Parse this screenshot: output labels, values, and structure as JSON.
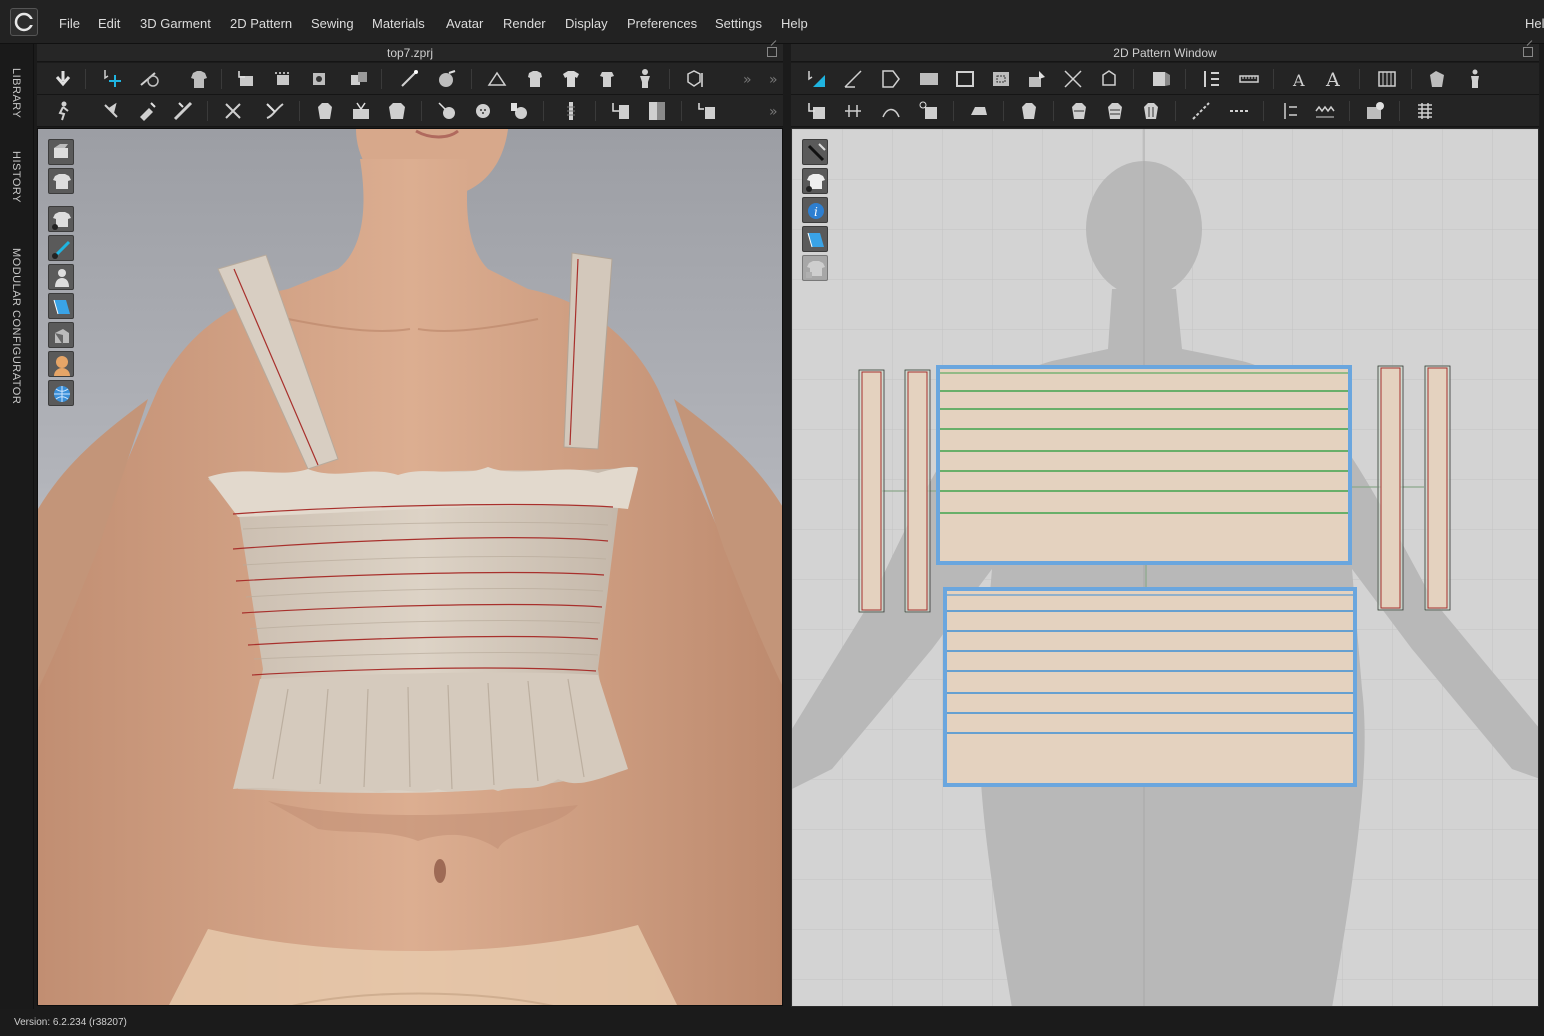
{
  "app": {
    "help_cut": "Hel",
    "menu": [
      "File",
      "Edit",
      "3D Garment",
      "2D Pattern",
      "Sewing",
      "Materials",
      "Avatar",
      "Render",
      "Display",
      "Preferences",
      "Settings",
      "Help"
    ]
  },
  "sidebar": {
    "tabs": [
      "LIBRARY",
      "HISTORY",
      "MODULAR CONFIGURATOR"
    ]
  },
  "panel_3d": {
    "title": "top7.zprj"
  },
  "panel_2d": {
    "title": "2D Pattern Window"
  },
  "status": {
    "version": "Version: 6.2.234 (r38207)"
  },
  "colors": {
    "fabric": "#e4d2bf",
    "seam_green": "#3fa34d",
    "seam_blue": "#3d8fd6",
    "selection_blue": "#6aa6de",
    "stitch_red": "#a8302c",
    "skin": "#d9a888"
  }
}
